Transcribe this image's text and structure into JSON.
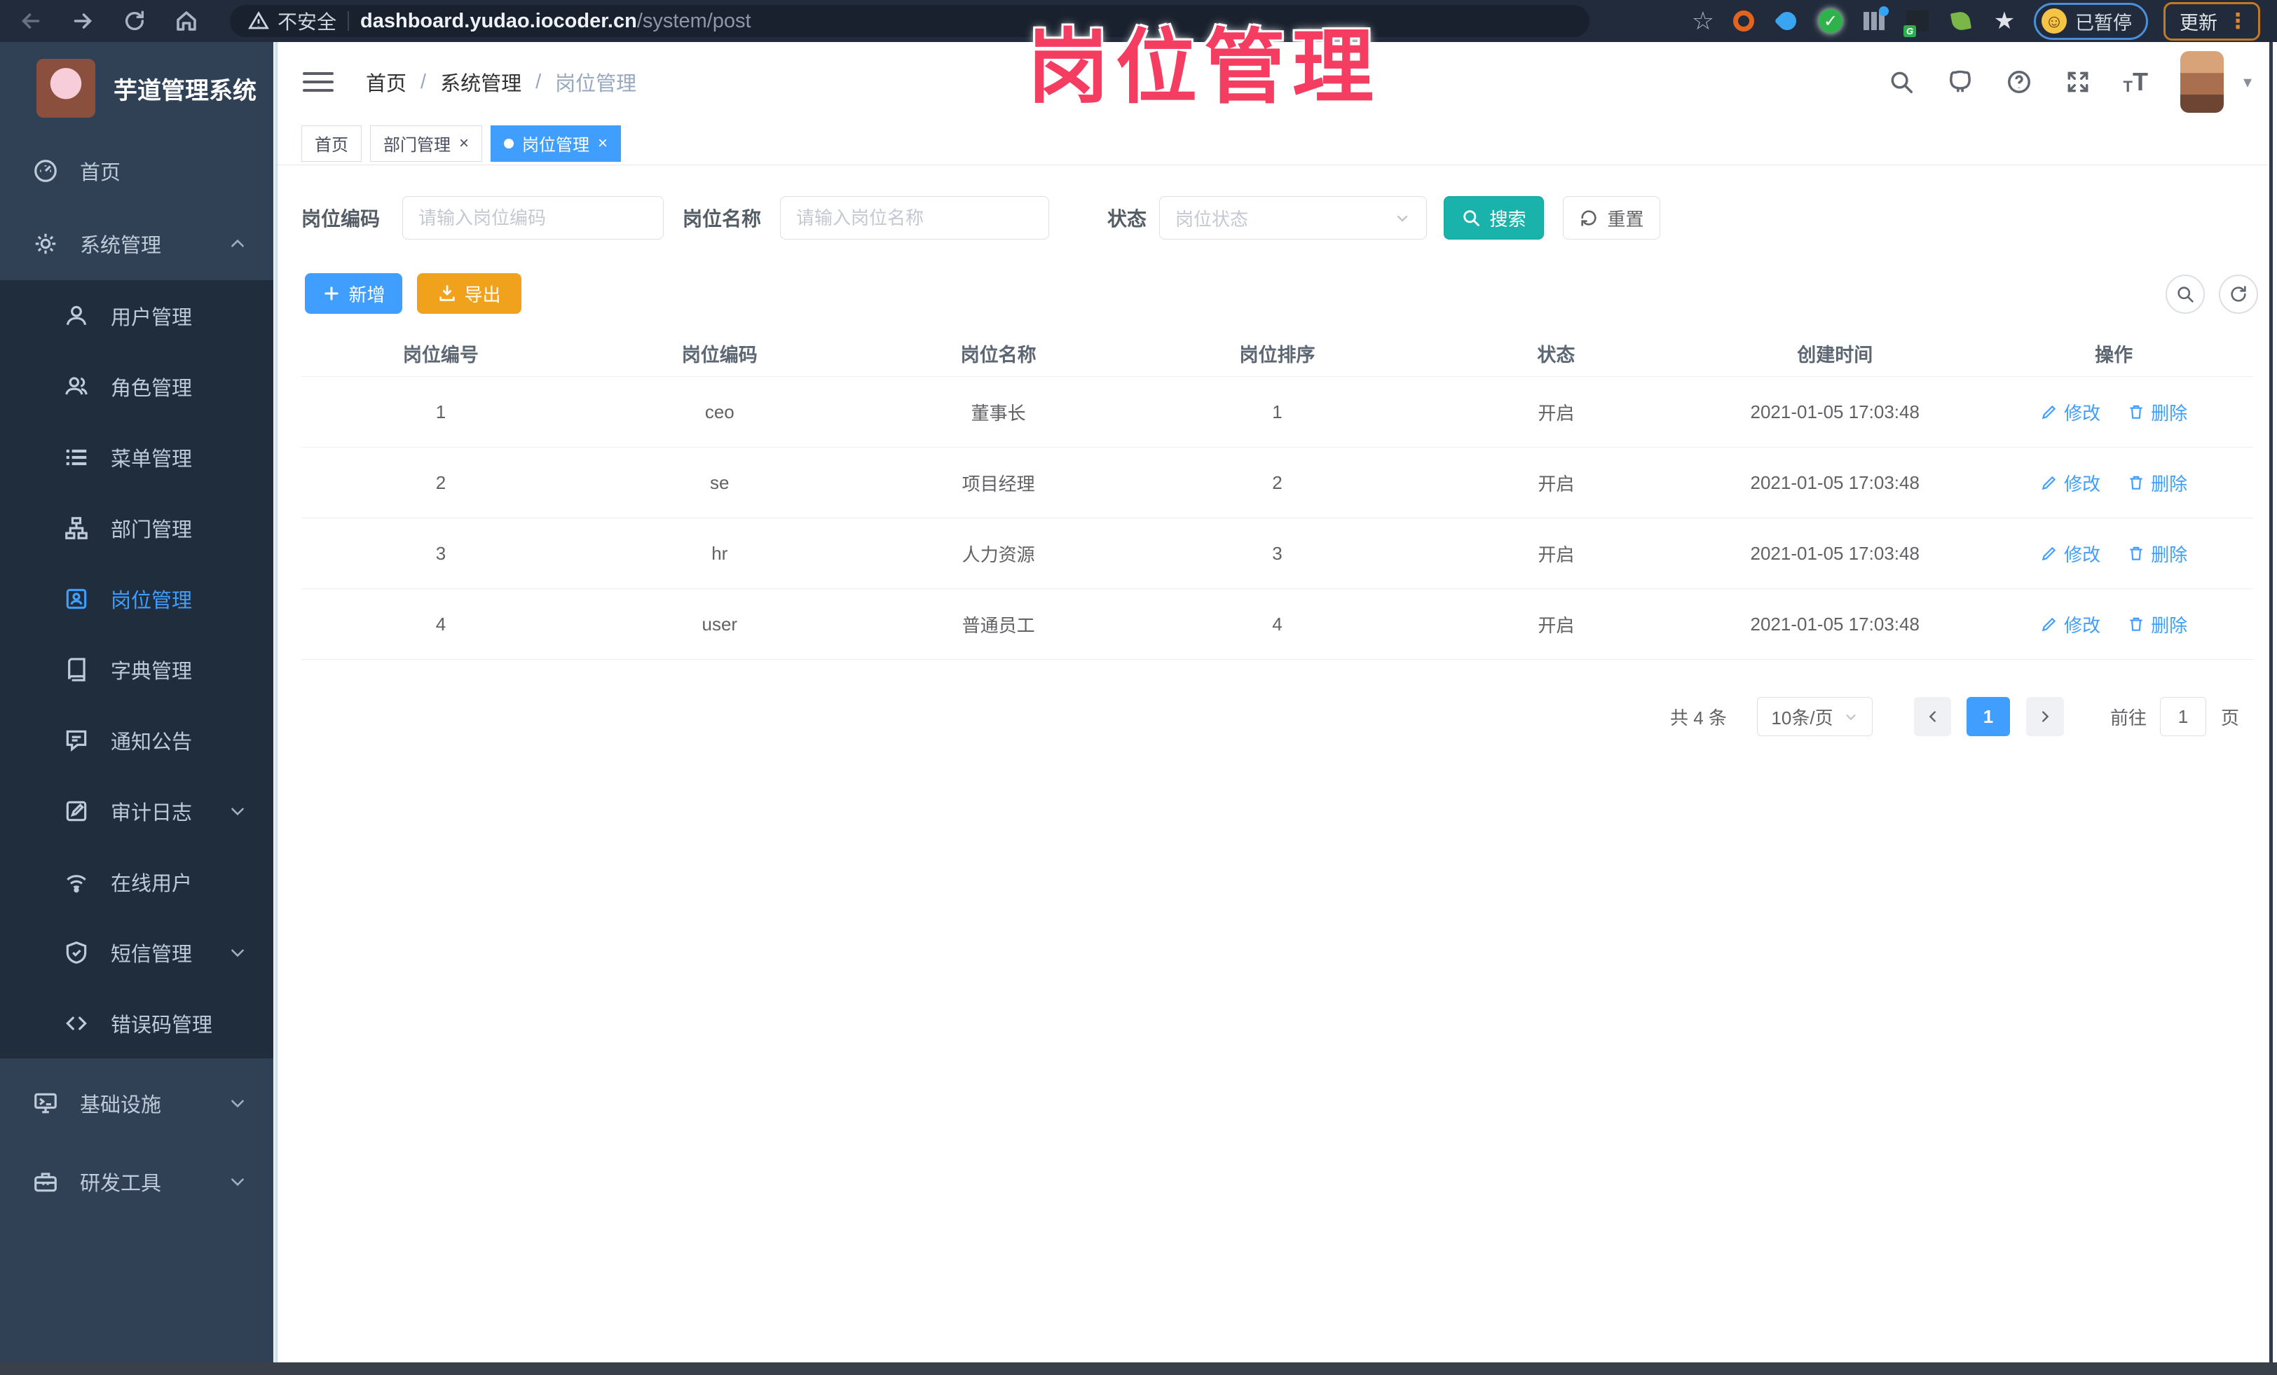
{
  "browser": {
    "security_label": "不安全",
    "url_host": "dashboard.yudao.iocoder.cn",
    "url_path": "/system/post",
    "paused_label": "已暂停",
    "update_label": "更新"
  },
  "annotation": {
    "text": "岗位管理"
  },
  "sidebar": {
    "app_title": "芋道管理系统",
    "items": [
      {
        "label": "首页",
        "icon": "dashboard-icon",
        "level": 1
      },
      {
        "label": "系统管理",
        "icon": "gear-icon",
        "level": 1,
        "expanded": true
      },
      {
        "label": "用户管理",
        "icon": "user-icon",
        "level": 2
      },
      {
        "label": "角色管理",
        "icon": "roles-icon",
        "level": 2
      },
      {
        "label": "菜单管理",
        "icon": "menu-list-icon",
        "level": 2
      },
      {
        "label": "部门管理",
        "icon": "org-tree-icon",
        "level": 2
      },
      {
        "label": "岗位管理",
        "icon": "post-badge-icon",
        "level": 2,
        "active": true
      },
      {
        "label": "字典管理",
        "icon": "dictionary-icon",
        "level": 2
      },
      {
        "label": "通知公告",
        "icon": "announcement-icon",
        "level": 2
      },
      {
        "label": "审计日志",
        "icon": "audit-log-icon",
        "level": 2,
        "has_children": true
      },
      {
        "label": "在线用户",
        "icon": "online-users-icon",
        "level": 2
      },
      {
        "label": "短信管理",
        "icon": "sms-shield-icon",
        "level": 2,
        "has_children": true
      },
      {
        "label": "错误码管理",
        "icon": "error-code-icon",
        "level": 2
      },
      {
        "label": "基础设施",
        "icon": "infrastructure-icon",
        "level": 1,
        "has_children": true
      },
      {
        "label": "研发工具",
        "icon": "dev-tools-icon",
        "level": 1,
        "has_children": true
      }
    ]
  },
  "header": {
    "breadcrumb": [
      "首页",
      "系统管理",
      "岗位管理"
    ]
  },
  "tabs": [
    {
      "label": "首页",
      "closable": false,
      "active": false
    },
    {
      "label": "部门管理",
      "closable": true,
      "active": false
    },
    {
      "label": "岗位管理",
      "closable": true,
      "active": true
    }
  ],
  "filters": {
    "post_code_label": "岗位编码",
    "post_code_placeholder": "请输入岗位编码",
    "post_name_label": "岗位名称",
    "post_name_placeholder": "请输入岗位名称",
    "status_label": "状态",
    "status_placeholder": "岗位状态",
    "search_label": "搜索",
    "reset_label": "重置"
  },
  "toolbar": {
    "add_label": "新增",
    "export_label": "导出"
  },
  "table": {
    "columns": [
      "岗位编号",
      "岗位编码",
      "岗位名称",
      "岗位排序",
      "状态",
      "创建时间",
      "操作"
    ],
    "edit_label": "修改",
    "delete_label": "删除",
    "rows": [
      {
        "id": "1",
        "code": "ceo",
        "name": "董事长",
        "sort": "1",
        "status": "开启",
        "created": "2021-01-05 17:03:48"
      },
      {
        "id": "2",
        "code": "se",
        "name": "项目经理",
        "sort": "2",
        "status": "开启",
        "created": "2021-01-05 17:03:48"
      },
      {
        "id": "3",
        "code": "hr",
        "name": "人力资源",
        "sort": "3",
        "status": "开启",
        "created": "2021-01-05 17:03:48"
      },
      {
        "id": "4",
        "code": "user",
        "name": "普通员工",
        "sort": "4",
        "status": "开启",
        "created": "2021-01-05 17:03:48"
      }
    ]
  },
  "pagination": {
    "total_label": "共 4 条",
    "page_size_label": "10条/页",
    "current_page": "1",
    "goto_label": "前往",
    "goto_value": "1",
    "unit_label": "页"
  },
  "colors": {
    "accent": "#409eff",
    "sidebar_bg": "#304156",
    "submenu_bg": "#1f2d3d",
    "search_button": "#19b3ac",
    "export_button": "#f0a21c",
    "annotation": "#f43d60",
    "browser_bar": "#212b3b"
  }
}
